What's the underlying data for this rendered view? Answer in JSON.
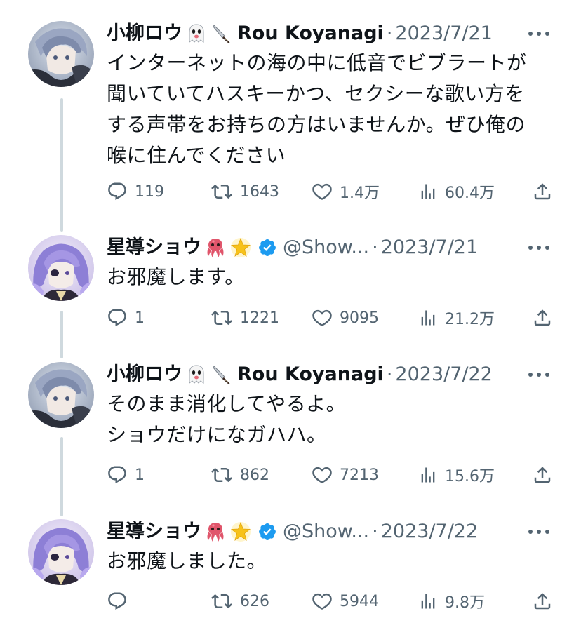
{
  "tweets": [
    {
      "name": "小柳ロウ",
      "emojis": [
        "ghost",
        "knife"
      ],
      "display_suffix": "Rou Koyanagi",
      "handle": "",
      "verified": false,
      "date": "2023/7/21",
      "text": "インターネットの海の中に低音でビブラートが\n聞いていてハスキーかつ、セクシーな歌い方を\nする声帯をお持ちの方はいませんか。ぜひ俺の\n喉に住んでください",
      "replies": "119",
      "retweets": "1643",
      "likes": "1.4万",
      "views": "60.4万",
      "avatar": "rou"
    },
    {
      "name": "星導ショウ",
      "emojis": [
        "octopus",
        "star"
      ],
      "display_suffix": "",
      "handle": "@Show...",
      "verified": true,
      "date": "2023/7/21",
      "text": "お邪魔します。",
      "replies": "1",
      "retweets": "1221",
      "likes": "9095",
      "views": "21.2万",
      "avatar": "shou"
    },
    {
      "name": "小柳ロウ",
      "emojis": [
        "ghost",
        "knife"
      ],
      "display_suffix": "Rou Koyanagi",
      "handle": "",
      "verified": false,
      "date": "2023/7/22",
      "text": "そのまま消化してやるよ。\nショウだけになガハハ。",
      "replies": "1",
      "retweets": "862",
      "likes": "7213",
      "views": "15.6万",
      "avatar": "rou"
    },
    {
      "name": "星導ショウ",
      "emojis": [
        "octopus",
        "star"
      ],
      "display_suffix": "",
      "handle": "@Show...",
      "verified": true,
      "date": "2023/7/22",
      "text": "お邪魔しました。",
      "replies": "",
      "retweets": "626",
      "likes": "5944",
      "views": "9.8万",
      "avatar": "shou"
    }
  ],
  "separator": "·",
  "colors": {
    "text": "#0f1419",
    "secondary": "#536471",
    "thread_line": "#cfd9de",
    "verified": "#1d9bf0"
  },
  "icons": {
    "reply": "reply-icon",
    "retweet": "retweet-icon",
    "like": "heart-icon",
    "views": "views-icon",
    "share": "share-icon",
    "more": "more-icon"
  }
}
